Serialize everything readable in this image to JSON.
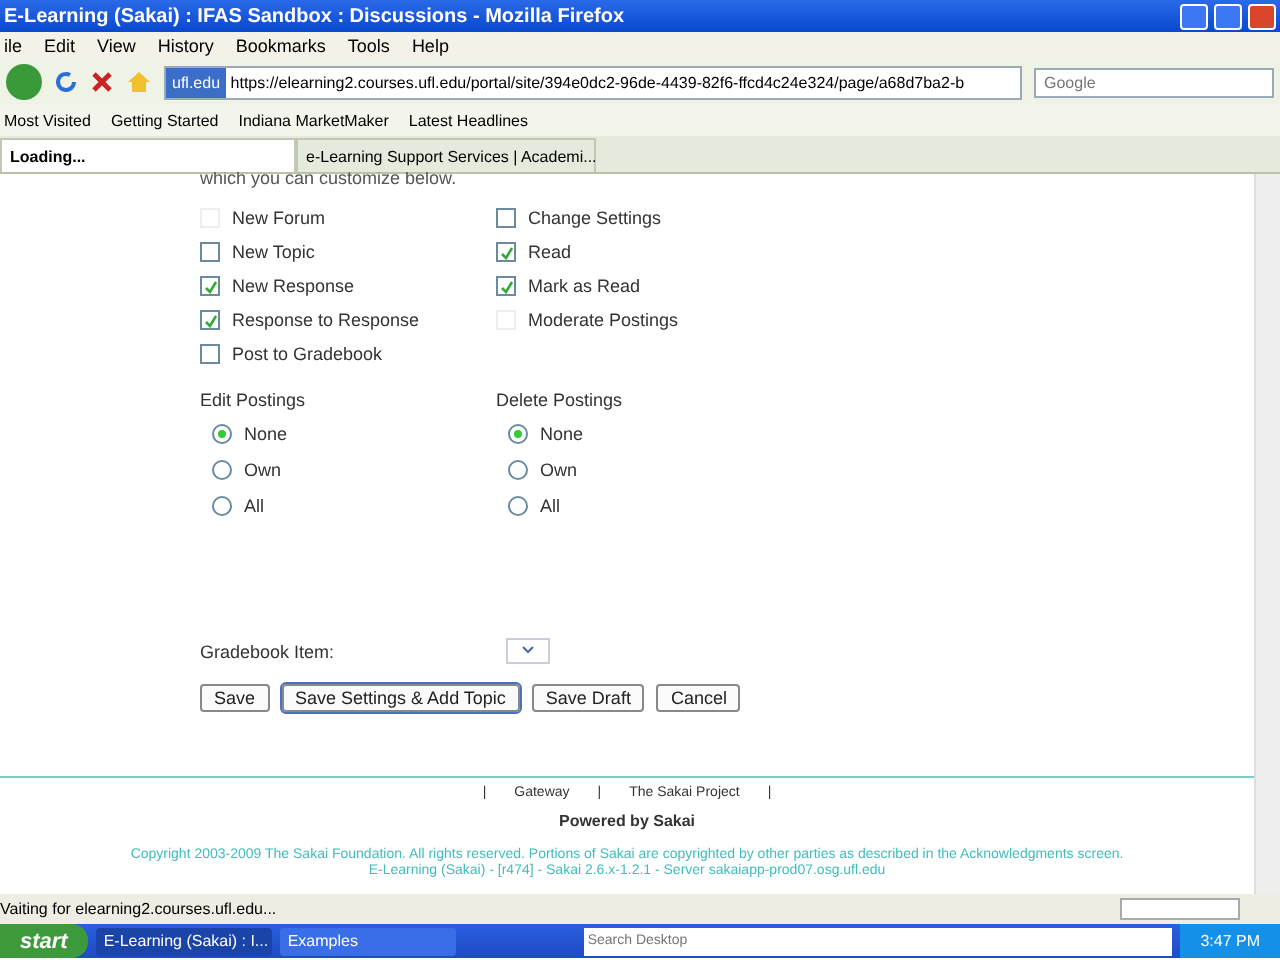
{
  "window": {
    "title": "E-Learning (Sakai) : IFAS Sandbox : Discussions - Mozilla Firefox"
  },
  "menu": [
    "ile",
    "Edit",
    "View",
    "History",
    "Bookmarks",
    "Tools",
    "Help"
  ],
  "address": {
    "site": "ufl.edu",
    "url": "https://elearning2.courses.ufl.edu/portal/site/394e0dc2-96de-4439-82f6-ffcd4c24e324/page/a68d7ba2-b"
  },
  "search": {
    "placeholder": "Google"
  },
  "bookmarks": [
    "Most Visited",
    "Getting Started",
    "Indiana MarketMaker",
    "Latest Headlines"
  ],
  "tabs": [
    {
      "label": "Loading...",
      "selected": true
    },
    {
      "label": "e-Learning Support Services | Academi...",
      "selected": false
    }
  ],
  "intro": "which you can customize below.",
  "permissions": [
    {
      "label": "New Forum",
      "checked": false,
      "disabled": true
    },
    {
      "label": "Change Settings",
      "checked": false,
      "disabled": false
    },
    {
      "label": "New Topic",
      "checked": false,
      "disabled": false
    },
    {
      "label": "Read",
      "checked": true,
      "disabled": false
    },
    {
      "label": "New Response",
      "checked": true,
      "disabled": false
    },
    {
      "label": "Mark as Read",
      "checked": true,
      "disabled": false
    },
    {
      "label": "Response to Response",
      "checked": true,
      "disabled": false
    },
    {
      "label": "Moderate Postings",
      "checked": false,
      "disabled": true
    },
    {
      "label": "Post to Gradebook",
      "checked": false,
      "disabled": false
    }
  ],
  "radio_groups": [
    {
      "title": "Edit Postings",
      "options": [
        {
          "label": "None",
          "selected": true
        },
        {
          "label": "Own",
          "selected": false
        },
        {
          "label": "All",
          "selected": false
        }
      ]
    },
    {
      "title": "Delete Postings",
      "options": [
        {
          "label": "None",
          "selected": true
        },
        {
          "label": "Own",
          "selected": false
        },
        {
          "label": "All",
          "selected": false
        }
      ]
    }
  ],
  "gradebook_item": {
    "label": "Gradebook Item:"
  },
  "buttons": [
    {
      "label": "Save",
      "selected": false
    },
    {
      "label": "Save Settings & Add Topic",
      "selected": true
    },
    {
      "label": "Save Draft",
      "selected": false
    },
    {
      "label": "Cancel",
      "selected": false
    }
  ],
  "footer": {
    "links": [
      "Gateway",
      "The Sakai Project"
    ],
    "separator": "|",
    "powered": "Powered by Sakai",
    "copyright": "Copyright 2003-2009 The Sakai Foundation. All rights reserved. Portions of Sakai are copyrighted by other parties as described in the Acknowledgments screen.",
    "server": "E-Learning (Sakai) - [r474] - Sakai 2.6.x-1.2.1 - Server sakaiapp-prod07.osg.ufl.edu"
  },
  "status_bar": {
    "text": "Vaiting for elearning2.courses.ufl.edu..."
  },
  "taskbar": {
    "start": "start",
    "items": [
      {
        "label": "E-Learning (Sakai) : I...",
        "selected": true
      },
      {
        "label": "Examples",
        "selected": false
      }
    ],
    "search": {
      "placeholder": "Search Desktop"
    },
    "clock": "3:47 PM"
  }
}
